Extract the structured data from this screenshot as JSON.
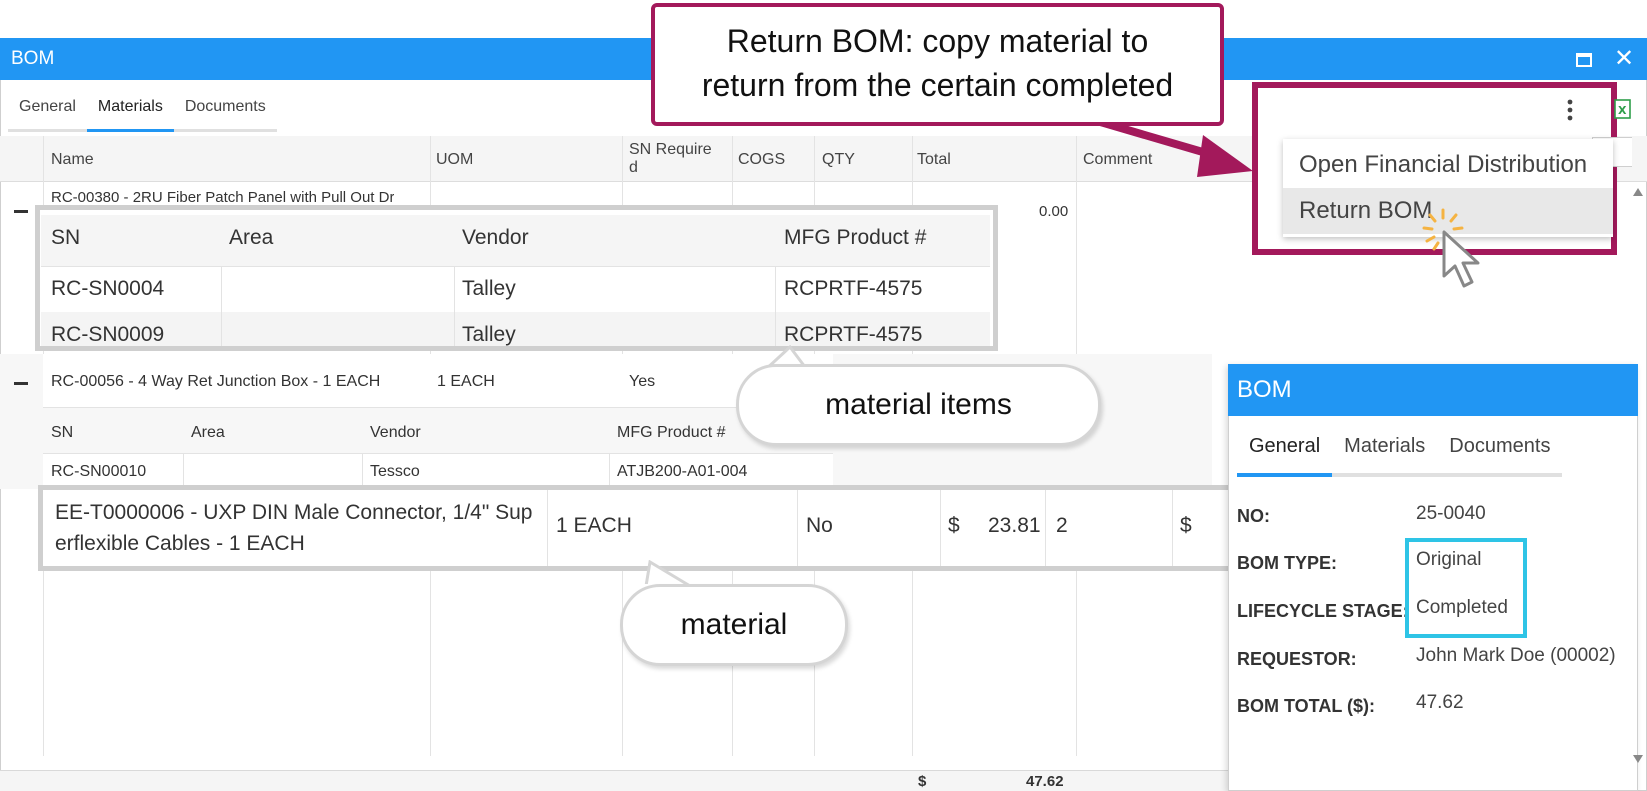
{
  "window": {
    "title": "BOM"
  },
  "tabs": [
    "General",
    "Materials",
    "Documents"
  ],
  "columns": {
    "name": "Name",
    "uom": "UOM",
    "sn_required": "SN Require\nd",
    "cogs": "COGS",
    "qty": "QTY",
    "total": "Total",
    "comment": "Comment"
  },
  "rows": [
    {
      "name": "RC-00380 - 2RU Fiber Patch Panel with Pull Out Dr",
      "total": "0.00",
      "sub_headers": {
        "sn": "SN",
        "area": "Area",
        "vendor": "Vendor",
        "mfg": "MFG Product #"
      },
      "items": [
        {
          "sn": "RC-SN0004",
          "area": "",
          "vendor": "Talley",
          "mfg": "RCPRTF-4575"
        },
        {
          "sn": "RC-SN0009",
          "area": "",
          "vendor": "Talley",
          "mfg": "RCPRTF-4575"
        }
      ]
    },
    {
      "name": "RC-00056 - 4 Way Ret Junction Box - 1 EACH",
      "uom": "1 EACH",
      "sn_required": "Yes",
      "sub_headers": {
        "sn": "SN",
        "area": "Area",
        "vendor": "Vendor",
        "mfg": "MFG Product #"
      },
      "items": [
        {
          "sn": "RC-SN00010",
          "area": "",
          "vendor": "Tessco",
          "mfg": "ATJB200-A01-004"
        }
      ]
    },
    {
      "name_line1": "EE-T0000006 - UXP DIN Male Connector, 1/4\" Sup",
      "name_line2": "erflexible Cables - 1 EACH",
      "uom": "1 EACH",
      "sn_required": "No",
      "cogs_currency": "$",
      "cogs": "23.81",
      "qty": "2",
      "total_currency": "$"
    }
  ],
  "footer": {
    "currency": "$",
    "total": "47.62"
  },
  "annotations": {
    "note_line1": "Return BOM: copy material to",
    "note_line2": "return from the certain completed",
    "material_items": "material items",
    "material": "material"
  },
  "menu": {
    "items": [
      "Open Financial Distribution",
      "Return BOM"
    ]
  },
  "popup": {
    "title": "BOM",
    "tabs": [
      "General",
      "Materials",
      "Documents"
    ],
    "fields": [
      {
        "label": "NO:",
        "value": "25-0040"
      },
      {
        "label": "BOM TYPE:",
        "value": "Original"
      },
      {
        "label": "LIFECYCLE STAGE:",
        "value": "Completed"
      },
      {
        "label": "REQUESTOR:",
        "value": "John Mark Doe (00002)"
      },
      {
        "label": "BOM TOTAL ($):",
        "value": "47.62"
      }
    ]
  },
  "colors": {
    "titlebar": "#2196f3",
    "link": "#1a73c8",
    "annotation": "#a3195b",
    "highlight": "#2ec4e6"
  }
}
